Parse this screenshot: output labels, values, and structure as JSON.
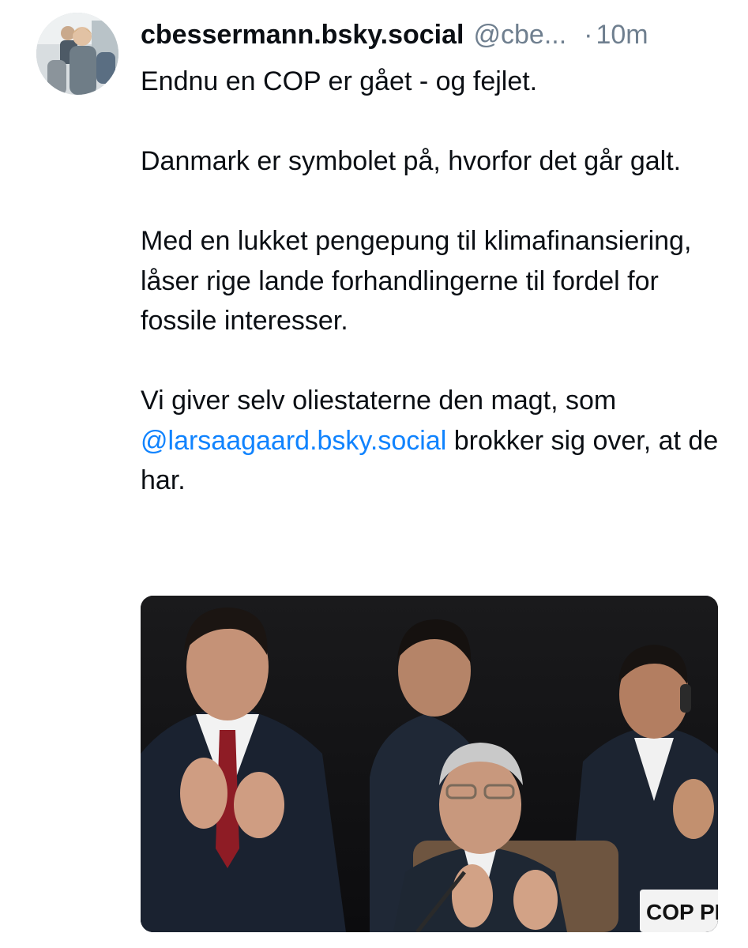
{
  "post": {
    "author": {
      "display_name": "cbessermann.bsky.social",
      "handle": "@cbe...",
      "avatar_icon": "avatar-photo"
    },
    "separator": "·",
    "time": "10m",
    "text": {
      "p1": "Endnu en COP er gået - og fejlet.",
      "p2": "Danmark er symbolet på, hvorfor det går galt.",
      "p3": "Med en lukket pengepung til klimafinansiering, låser rige lande forhandlingerne til fordel for fossile interesser.",
      "p4_before": "Vi giver selv oliestaterne den magt, som",
      "p4_mention": "@larsaagaard.bsky.social",
      "p4_after": "brokker sig over, at de har."
    },
    "image": {
      "nameplate_text": "COP PR"
    }
  },
  "colors": {
    "text": "#0b0f14",
    "muted": "#6f7f8f",
    "link": "#1083fe"
  }
}
